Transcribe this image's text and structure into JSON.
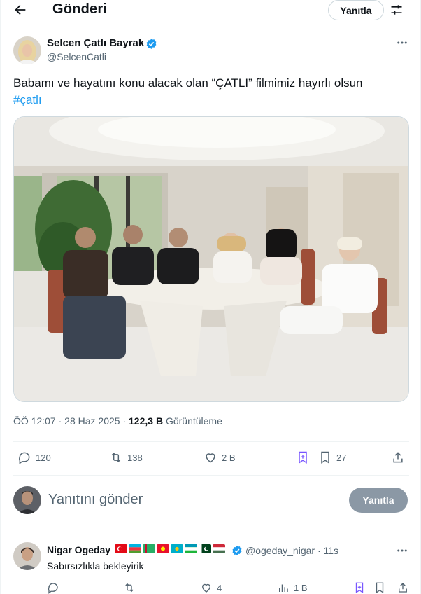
{
  "header": {
    "title": "Gönderi",
    "reply_button": "Yanıtla"
  },
  "post": {
    "author_name": "Selcen Çatlı Bayrak",
    "author_handle": "@SelcenCatli",
    "text": "Babamı ve hayatını konu alacak olan “ÇATLI” filmimiz hayırlı olsun",
    "hashtag": "#çatlı",
    "time": "ÖÖ 12:07",
    "date": "28 Haz 2025",
    "views_count": "122,3 B",
    "views_label": "Görüntüleme",
    "stats": {
      "replies": "120",
      "reposts": "138",
      "likes": "2 B",
      "bookmarks": "27"
    }
  },
  "composer": {
    "placeholder": "Yanıtını gönder",
    "button": "Yanıtla"
  },
  "reply": {
    "author_name": "Nigar Ogeday",
    "author_handle": "@ogeday_nigar",
    "age": "11s",
    "text": "Sabırsızlıkla bekleyirik",
    "stats": {
      "likes": "4",
      "views": "1 B"
    }
  },
  "colors": {
    "accent": "#1d9bf0",
    "verified": "#1d9bf0",
    "grok": "#7856ff",
    "muted": "#536471"
  }
}
